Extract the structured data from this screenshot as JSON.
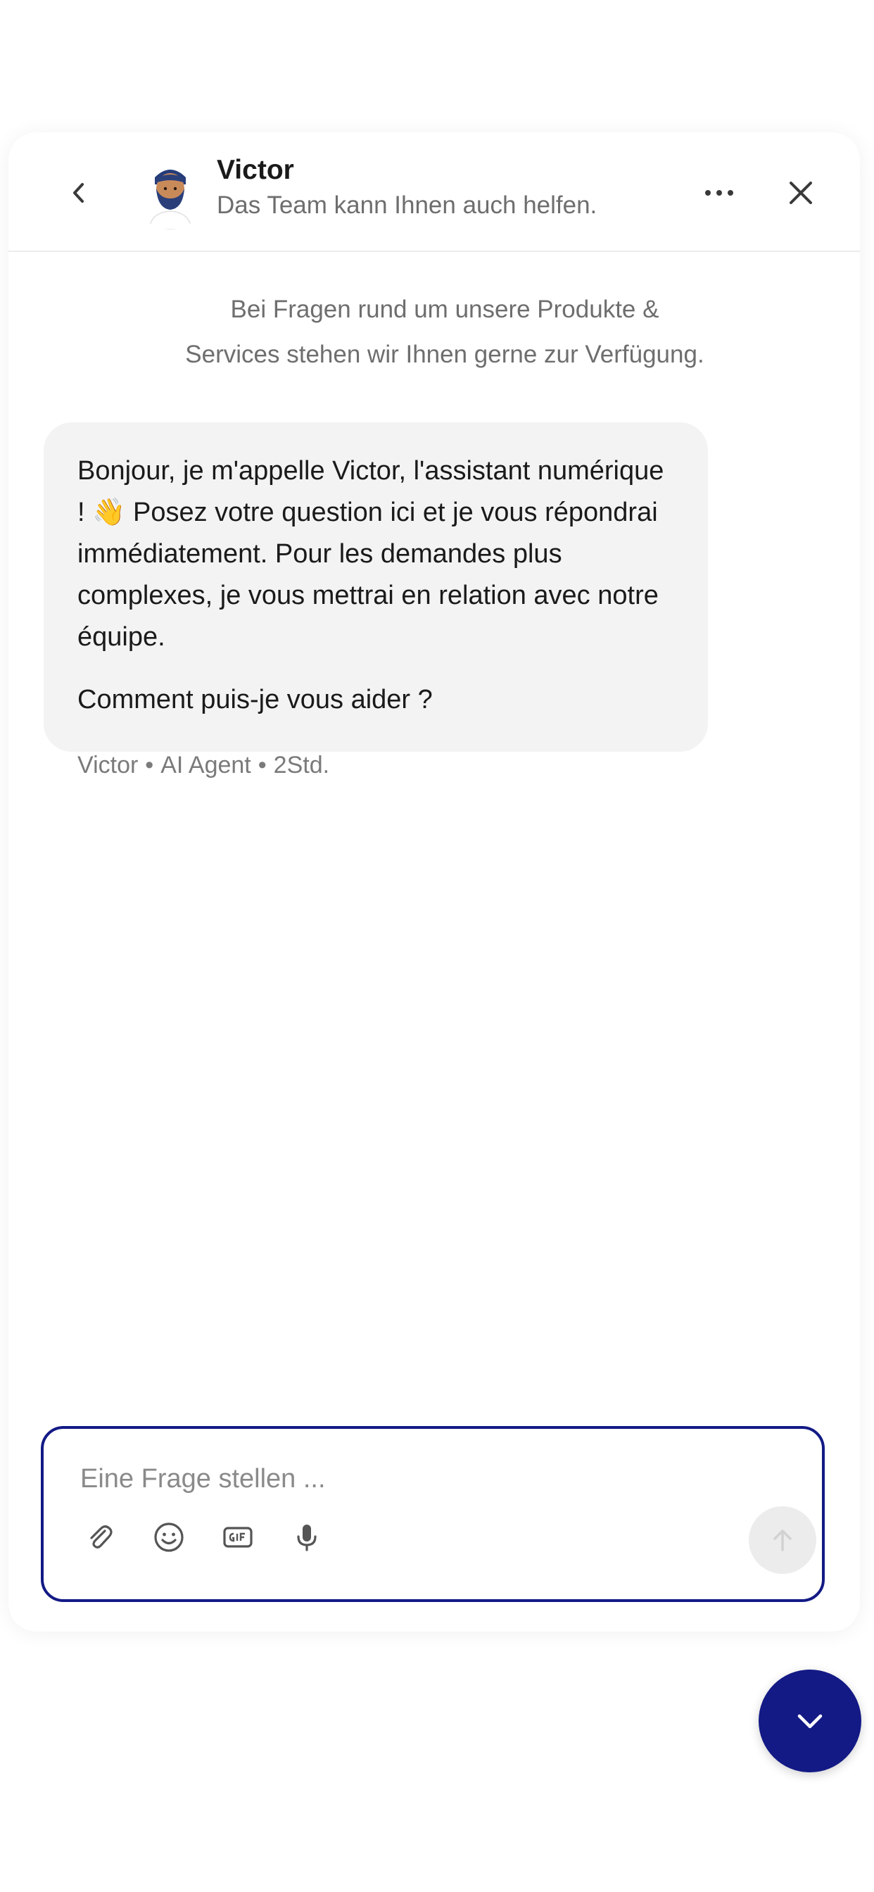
{
  "header": {
    "back_icon": "chevron-left-icon",
    "agent_name": "Victor",
    "agent_subtitle": "Das Team kann Ihnen auch helfen.",
    "more_icon": "more-horizontal-icon",
    "close_icon": "close-icon"
  },
  "intro": {
    "line1": "Bei Fragen rund um unsere Produkte &",
    "line2": "Services stehen wir Ihnen gerne zur Verfügung."
  },
  "message": {
    "paragraph1_part1": "Bonjour, je m'appelle Victor, l'assistant numérique ! ",
    "emoji": "👋",
    "paragraph1_part2": " Posez votre question ici et je vous répondrai immédiatement. Pour les demandes plus complexes, je vous mettrai en relation avec notre équipe.",
    "paragraph2": "Comment puis-je vous aider ?",
    "meta_sender": "Victor",
    "meta_role": "AI Agent",
    "meta_time": "2Std.",
    "meta_separator": "•"
  },
  "composer": {
    "placeholder": "Eine Frage stellen ...",
    "value": "",
    "tools": [
      "attachment-icon",
      "emoji-icon",
      "gif-icon",
      "microphone-icon"
    ],
    "send_icon": "arrow-up-icon"
  },
  "launcher": {
    "icon": "chevron-down-icon"
  },
  "colors": {
    "accent": "#131a85",
    "bubble_bg": "#f3f3f3",
    "muted_text": "#6e6e6e",
    "send_disabled_bg": "#ececec"
  }
}
